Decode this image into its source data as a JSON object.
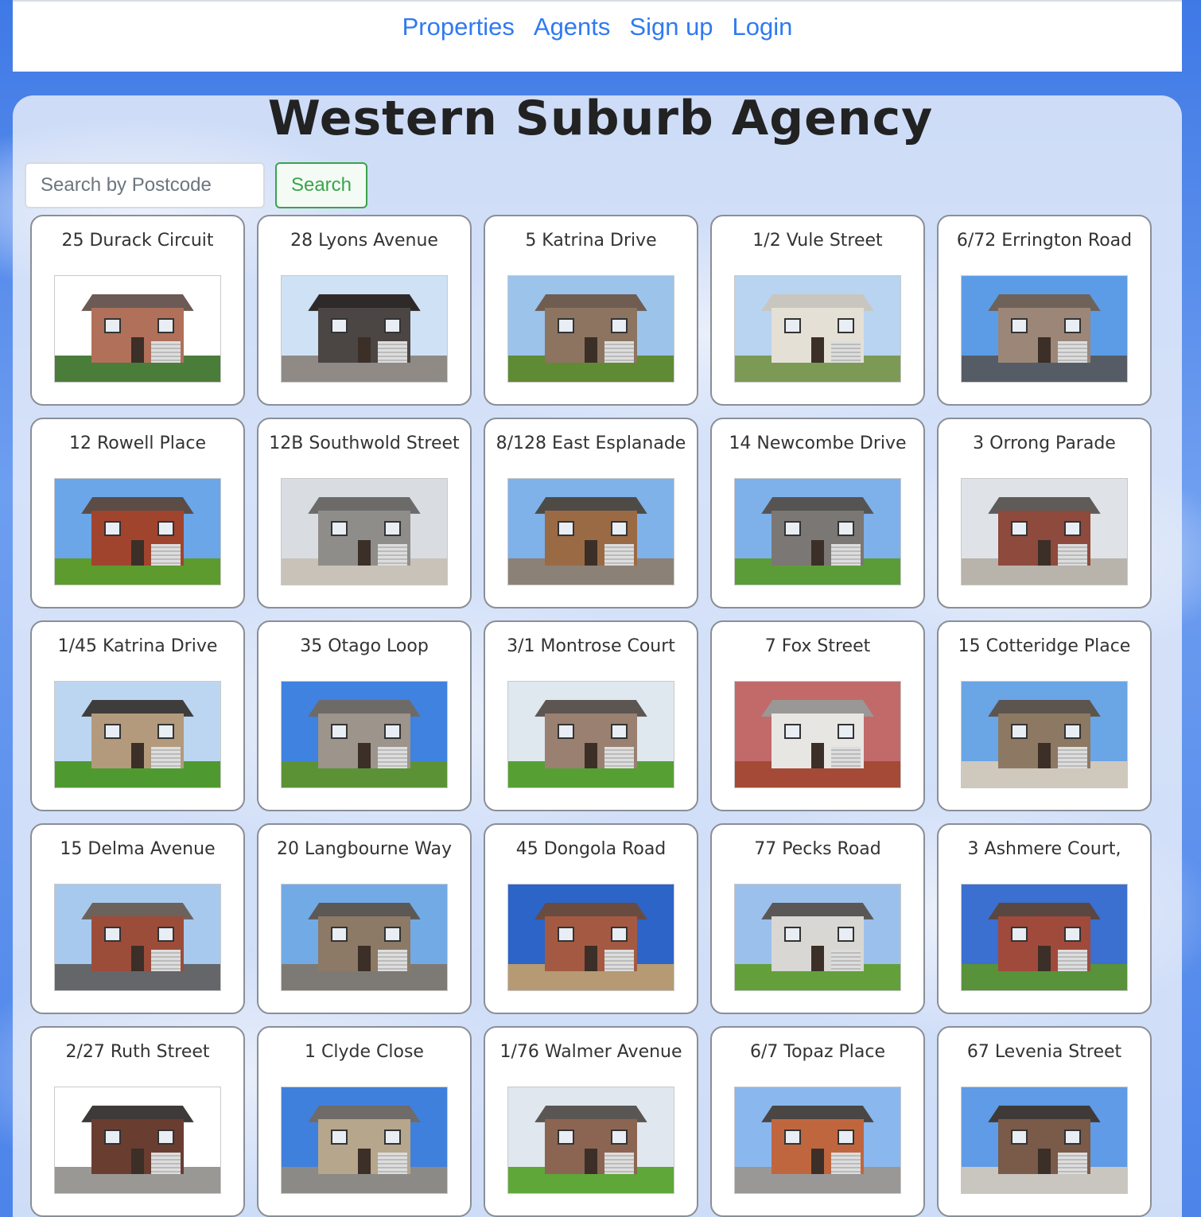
{
  "nav": {
    "links": [
      "Properties",
      "Agents",
      "Sign up",
      "Login"
    ]
  },
  "page": {
    "title": "Western Suburb Agency"
  },
  "search": {
    "placeholder": "Search by Postcode",
    "button_label": "Search"
  },
  "properties": [
    {
      "address": "25 Durack Circuit",
      "wall": "#b0705a",
      "roof": "#6b5a55",
      "sky": "#ffffff",
      "ground": "#4a7d3a"
    },
    {
      "address": "28 Lyons Avenue",
      "wall": "#4b4644",
      "roof": "#2e2a29",
      "sky": "#cfe2f5",
      "ground": "#8f8a86"
    },
    {
      "address": "5 Katrina Drive",
      "wall": "#8c7460",
      "roof": "#6f5d52",
      "sky": "#9cc3ea",
      "ground": "#5f8b34"
    },
    {
      "address": "1/2 Vule Street",
      "wall": "#e4e0d6",
      "roof": "#c9c6bf",
      "sky": "#b8d4f0",
      "ground": "#7c9a55"
    },
    {
      "address": "6/72 Errington Road",
      "wall": "#9c8677",
      "roof": "#6e6259",
      "sky": "#5c9ce6",
      "ground": "#555c66"
    },
    {
      "address": "12 Rowell Place",
      "wall": "#a1442e",
      "roof": "#5b4c46",
      "sky": "#6aa6e8",
      "ground": "#5d9b2e"
    },
    {
      "address": "12B Southwold Street",
      "wall": "#8f8d8a",
      "roof": "#6d6b69",
      "sky": "#d9dde2",
      "ground": "#c8c2b9"
    },
    {
      "address": "8/128 East Esplanade",
      "wall": "#9a6a45",
      "roof": "#4e4a45",
      "sky": "#7fb2e8",
      "ground": "#8c8176"
    },
    {
      "address": "14 Newcombe Drive",
      "wall": "#7a7774",
      "roof": "#565452",
      "sky": "#7eb1ea",
      "ground": "#5c9c38"
    },
    {
      "address": "3 Orrong Parade",
      "wall": "#8e4a3c",
      "roof": "#5f5b58",
      "sky": "#dfe3e8",
      "ground": "#b8b3ab"
    },
    {
      "address": "1/45 Katrina Drive",
      "wall": "#b39a7c",
      "roof": "#3f3d3c",
      "sky": "#bcd6f2",
      "ground": "#4f9a30"
    },
    {
      "address": "35 Otago Loop",
      "wall": "#9d948b",
      "roof": "#6e6a67",
      "sky": "#3f82e0",
      "ground": "#5b9236"
    },
    {
      "address": "3/1 Montrose Court",
      "wall": "#9a8070",
      "roof": "#5c5552",
      "sky": "#dfe7ef",
      "ground": "#56a033"
    },
    {
      "address": "7 Fox Street",
      "wall": "#e8e6e3",
      "roof": "#9a9896",
      "sky": "#c26a6a",
      "ground": "#a44a36"
    },
    {
      "address": "15 Cotteridge Place",
      "wall": "#8d7963",
      "roof": "#5c544e",
      "sky": "#6aa5e6",
      "ground": "#cfc8bd"
    },
    {
      "address": "15 Delma Avenue",
      "wall": "#9c4d3a",
      "roof": "#6c625c",
      "sky": "#a7c9ee",
      "ground": "#64666a"
    },
    {
      "address": "20 Langbourne Way",
      "wall": "#8c7a66",
      "roof": "#5b5856",
      "sky": "#72aae6",
      "ground": "#7d7a76"
    },
    {
      "address": "45 Dongola Road",
      "wall": "#a45a42",
      "roof": "#6a4b40",
      "sky": "#2c64c8",
      "ground": "#b59a74"
    },
    {
      "address": "77 Pecks Road",
      "wall": "#d9d7d3",
      "roof": "#5a5856",
      "sky": "#9cc0ec",
      "ground": "#63a03c"
    },
    {
      "address": "3 Ashmere Court,",
      "wall": "#a04a3c",
      "roof": "#5a4742",
      "sky": "#3b6fd0",
      "ground": "#58923a"
    },
    {
      "address": "2/27 Ruth Street",
      "wall": "#6a3d31",
      "roof": "#3d3a39",
      "sky": "#ffffff",
      "ground": "#9a9894"
    },
    {
      "address": "1 Clyde Close",
      "wall": "#b5a68c",
      "roof": "#6e6b68",
      "sky": "#3f80dc",
      "ground": "#8c8a87"
    },
    {
      "address": "1/76 Walmer Avenue",
      "wall": "#8b6552",
      "roof": "#5a5654",
      "sky": "#e0e7ee",
      "ground": "#5ea738"
    },
    {
      "address": "6/7 Topaz Place",
      "wall": "#c0663e",
      "roof": "#4a4644",
      "sky": "#8ab8ee",
      "ground": "#9a9896"
    },
    {
      "address": "67 Levenia Street",
      "wall": "#7a5a48",
      "roof": "#3f3a38",
      "sky": "#5f9be6",
      "ground": "#c9c6c0"
    }
  ]
}
